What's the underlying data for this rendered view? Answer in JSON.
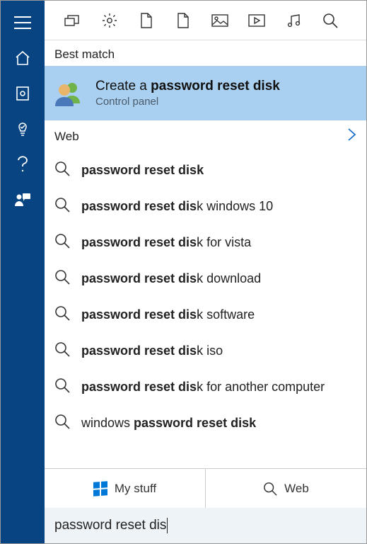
{
  "sections": {
    "best_match": "Best match",
    "web": "Web"
  },
  "best_match": {
    "title_pre": "Create a ",
    "title_bold": "password reset disk",
    "subtitle": "Control panel"
  },
  "web_results": [
    {
      "bold": "password reset disk",
      "rest": ""
    },
    {
      "bold": "password reset dis",
      "rest": "k windows 10"
    },
    {
      "bold": "password reset dis",
      "rest": "k for vista"
    },
    {
      "bold": "password reset dis",
      "rest": "k download"
    },
    {
      "bold": "password reset dis",
      "rest": "k software"
    },
    {
      "bold": "password reset dis",
      "rest": "k iso"
    },
    {
      "bold": "password reset dis",
      "rest": "k for another computer"
    },
    {
      "pre": "windows ",
      "bold": "password reset disk",
      "rest": ""
    }
  ],
  "filters": {
    "my_stuff": "My stuff",
    "web": "Web"
  },
  "search": {
    "query": "password reset dis"
  }
}
